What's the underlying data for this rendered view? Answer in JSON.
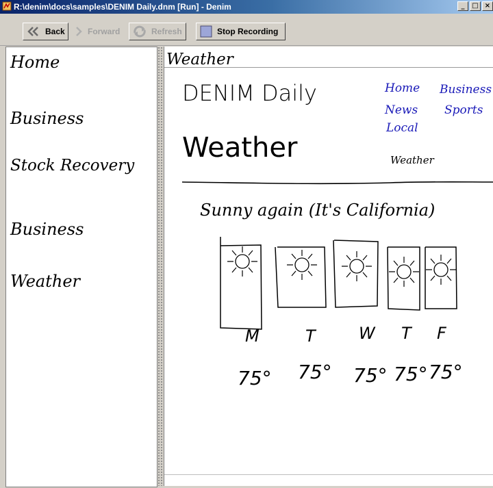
{
  "window": {
    "title": "R:\\denim\\docs\\samples\\DENIM Daily.dnm [Run] - Denim",
    "minimize": "_",
    "maximize": "□",
    "close": "×"
  },
  "toolbar": {
    "back": "Back",
    "forward": "Forward",
    "refresh": "Refresh",
    "stop": "Stop Recording"
  },
  "sidebar": {
    "items": [
      "Home",
      "Business",
      "Stock Recovery",
      "Business",
      "Weather"
    ]
  },
  "page": {
    "label": "Weather",
    "site_title": "DENIM Daily",
    "section_title": "Weather",
    "nav": [
      "Home",
      "Business",
      "News",
      "Sports",
      "Local",
      "Weather"
    ],
    "headline": "Sunny again (It's California)",
    "forecast": {
      "days": [
        "M",
        "T",
        "W",
        "T",
        "F"
      ],
      "temps": [
        "75°",
        "75°",
        "75°",
        "75°",
        "75°"
      ],
      "icon": "sun-icon"
    }
  },
  "colors": {
    "title_bar": "#0a246a",
    "nav_links": "#1a1ab8",
    "window_bg": "#d4d0c8"
  }
}
